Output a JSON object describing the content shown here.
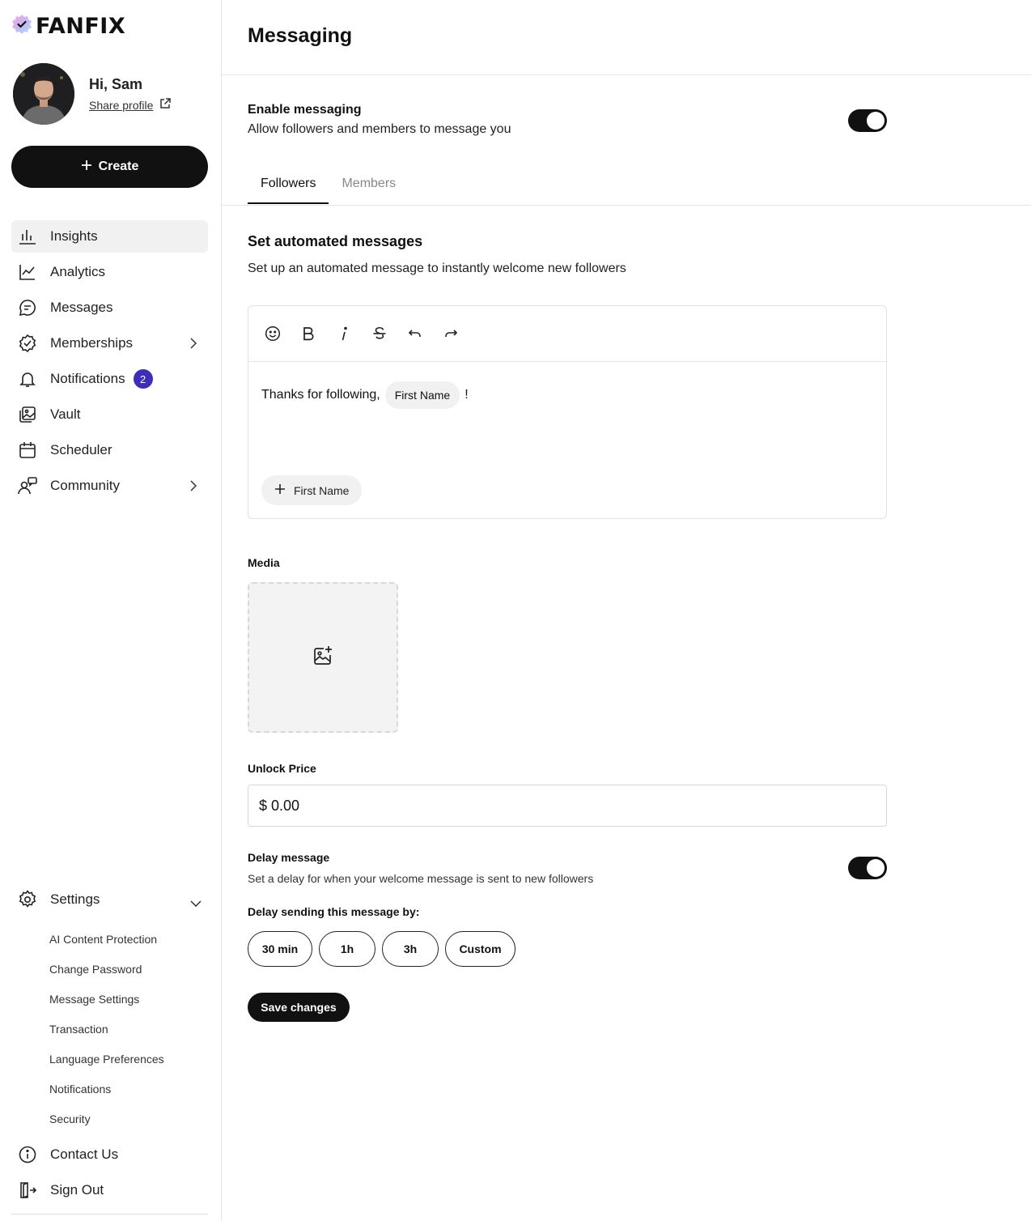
{
  "brand": {
    "name": "FANFIX",
    "accent": "#3d2db8"
  },
  "profile": {
    "greeting": "Hi, Sam",
    "share_label": "Share profile"
  },
  "create_label": "Create",
  "nav": [
    {
      "label": "Insights",
      "icon": "bar-chart-icon",
      "active": true
    },
    {
      "label": "Analytics",
      "icon": "line-chart-icon"
    },
    {
      "label": "Messages",
      "icon": "message-bubble-icon"
    },
    {
      "label": "Memberships",
      "icon": "badge-check-icon",
      "chevron": true
    },
    {
      "label": "Notifications",
      "icon": "bell-icon",
      "badge": "2"
    },
    {
      "label": "Vault",
      "icon": "image-stack-icon"
    },
    {
      "label": "Scheduler",
      "icon": "calendar-icon"
    },
    {
      "label": "Community",
      "icon": "community-icon",
      "chevron": true
    }
  ],
  "settings": {
    "label": "Settings",
    "items": [
      "AI Content Protection",
      "Change Password",
      "Message Settings",
      "Transaction",
      "Language Preferences",
      "Notifications",
      "Security"
    ]
  },
  "bottom_nav": [
    {
      "label": "Contact Us",
      "icon": "info-icon"
    },
    {
      "label": "Sign Out",
      "icon": "sign-out-icon"
    }
  ],
  "main": {
    "title": "Messaging",
    "enable": {
      "title": "Enable messaging",
      "desc": "Allow followers and members to message you",
      "on": true
    },
    "tabs": [
      {
        "label": "Followers",
        "active": true
      },
      {
        "label": "Members"
      }
    ],
    "auto": {
      "title": "Set automated messages",
      "desc": "Set up an automated message to instantly welcome new followers"
    },
    "editor": {
      "text_before": "Thanks for following,",
      "chip": "First Name",
      "text_after": "!",
      "add_chip": "First Name"
    },
    "media_label": "Media",
    "price": {
      "label": "Unlock Price",
      "value": "$ 0.00"
    },
    "delay": {
      "title": "Delay message",
      "desc": "Set a delay for when your welcome message is sent to new followers",
      "on": true,
      "by_label": "Delay sending this message by:",
      "options": [
        "30 min",
        "1h",
        "3h",
        "Custom"
      ]
    },
    "save_label": "Save changes"
  }
}
